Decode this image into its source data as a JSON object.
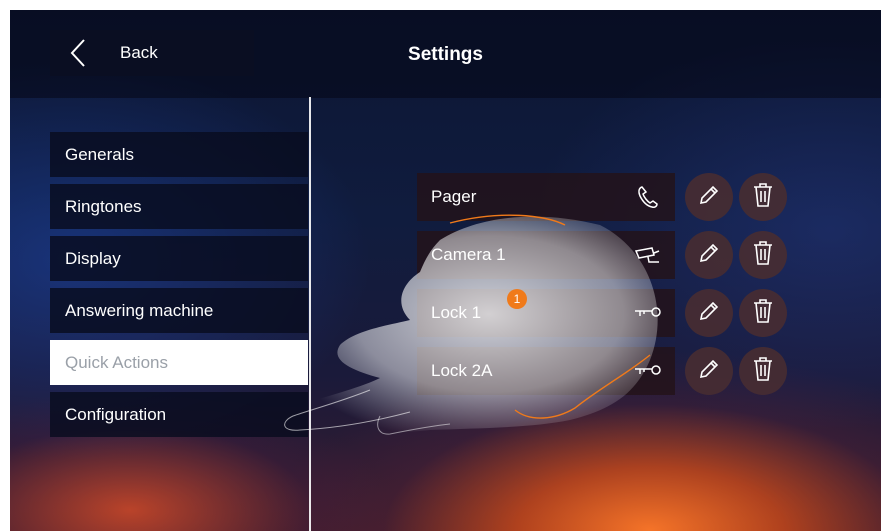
{
  "header": {
    "back_label": "Back",
    "title": "Settings"
  },
  "menu": {
    "items": [
      {
        "label": "Generals"
      },
      {
        "label": "Ringtones"
      },
      {
        "label": "Display"
      },
      {
        "label": "Answering machine"
      },
      {
        "label": "Quick Actions"
      },
      {
        "label": "Configuration"
      }
    ],
    "selected": "Quick Actions"
  },
  "quick_actions": [
    {
      "label": "Pager",
      "icon": "phone-handset-icon"
    },
    {
      "label": "Camera 1",
      "icon": "camera-icon"
    },
    {
      "label": "Lock 1",
      "icon": "key-icon"
    },
    {
      "label": "Lock 2A",
      "icon": "key-icon"
    }
  ],
  "callout": {
    "number": "1"
  },
  "colors": {
    "accent": "#f07a1a",
    "selected_item_text": "#9aa0a8"
  }
}
